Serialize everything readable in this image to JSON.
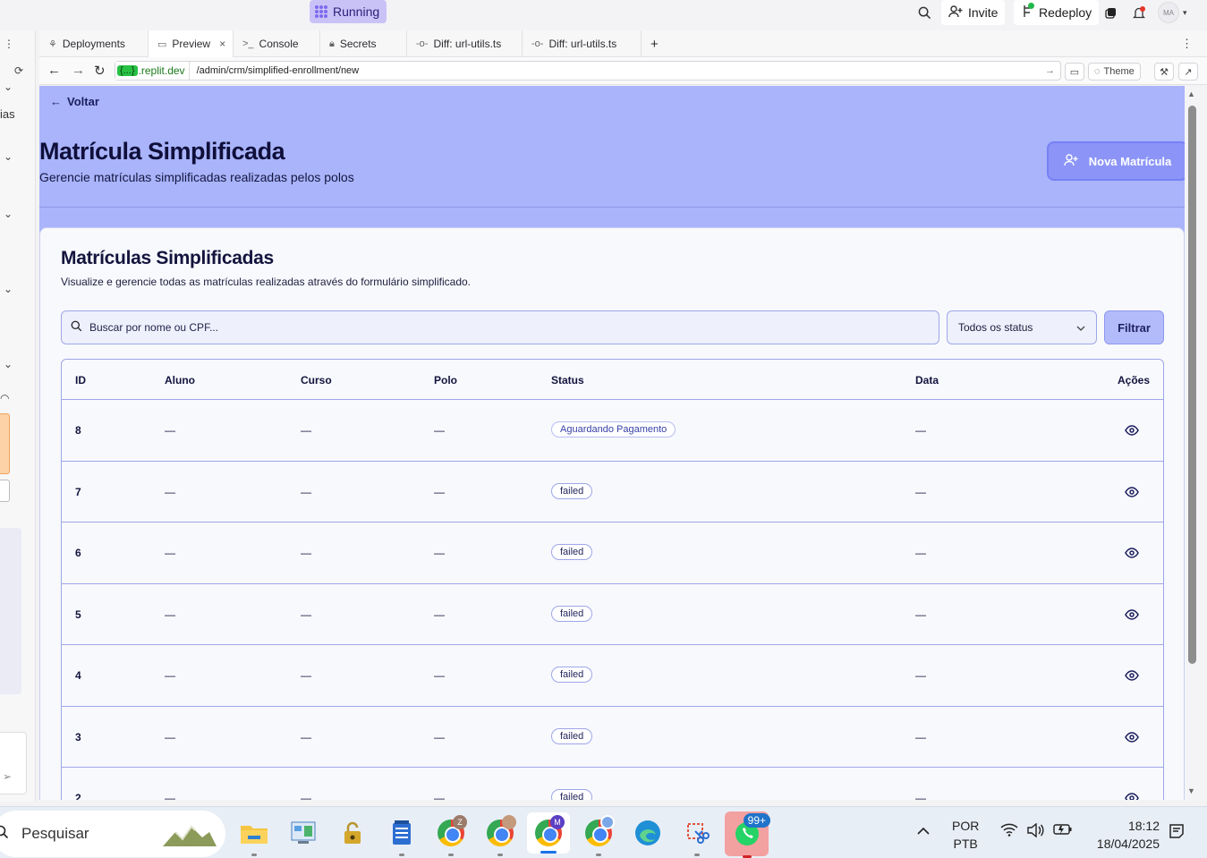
{
  "topbar": {
    "status": "Running",
    "invite": "Invite",
    "redeploy": "Redeploy",
    "avatar": "MA"
  },
  "sidebar": {
    "partial_label": "ias"
  },
  "tabs": [
    {
      "label": "Deployments",
      "icon": "deployments-icon"
    },
    {
      "label": "Preview",
      "icon": "monitor-icon",
      "active": true
    },
    {
      "label": "Console",
      "icon": "terminal-icon"
    },
    {
      "label": "Secrets",
      "icon": "lock-icon"
    },
    {
      "label": "Diff: url-utils.ts",
      "icon": "diff-icon"
    },
    {
      "label": "Diff: url-utils.ts",
      "icon": "diff-icon"
    }
  ],
  "urlbar": {
    "domain_chip": "{...}",
    "domain": ".replit.dev",
    "path": "/admin/crm/simplified-enrollment/new",
    "theme_label": "Theme"
  },
  "page": {
    "back_label": "Voltar",
    "title": "Matrícula Simplificada",
    "subtitle": "Gerencie matrículas simplificadas realizadas pelos polos",
    "new_button": "Nova Matrícula"
  },
  "card": {
    "title": "Matrículas Simplificadas",
    "description": "Visualize e gerencie todas as matrículas realizadas através do formulário simplificado.",
    "search_placeholder": "Buscar por nome ou CPF...",
    "status_select": "Todos os status",
    "filter_button": "Filtrar"
  },
  "table": {
    "headers": {
      "id": "ID",
      "aluno": "Aluno",
      "curso": "Curso",
      "polo": "Polo",
      "status": "Status",
      "data": "Data",
      "acoes": "Ações"
    },
    "rows": [
      {
        "id": "8",
        "aluno": "—",
        "curso": "—",
        "polo": "—",
        "status": "Aguardando Pagamento",
        "data": "—"
      },
      {
        "id": "7",
        "aluno": "—",
        "curso": "—",
        "polo": "—",
        "status": "failed",
        "data": "—"
      },
      {
        "id": "6",
        "aluno": "—",
        "curso": "—",
        "polo": "—",
        "status": "failed",
        "data": "—"
      },
      {
        "id": "5",
        "aluno": "—",
        "curso": "—",
        "polo": "—",
        "status": "failed",
        "data": "—"
      },
      {
        "id": "4",
        "aluno": "—",
        "curso": "—",
        "polo": "—",
        "status": "failed",
        "data": "—"
      },
      {
        "id": "3",
        "aluno": "—",
        "curso": "—",
        "polo": "—",
        "status": "failed",
        "data": "—"
      },
      {
        "id": "2",
        "aluno": "—",
        "curso": "—",
        "polo": "—",
        "status": "failed",
        "data": "—"
      }
    ]
  },
  "taskbar": {
    "search_placeholder": "Pesquisar",
    "whatsapp_badge": "99+",
    "chrome_profile_1": "Z",
    "chrome_profile_3": "M",
    "lang_1": "POR",
    "lang_2": "PTB",
    "time": "18:12",
    "date": "18/04/2025"
  },
  "colors": {
    "header_bg": "#a9b4fb",
    "accent": "#8c95f7",
    "running_bg": "#c9c2f7"
  }
}
